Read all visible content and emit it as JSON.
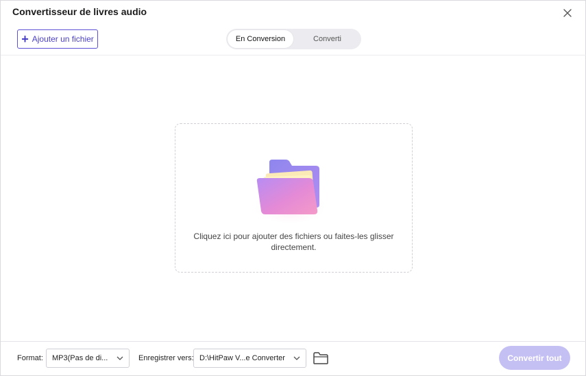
{
  "window": {
    "title": "Convertisseur de livres audio"
  },
  "toolbar": {
    "add_file_label": "Ajouter un fichier"
  },
  "tabs": [
    {
      "label": "En Conversion",
      "active": true
    },
    {
      "label": "Converti",
      "active": false
    }
  ],
  "dropzone": {
    "line1": "Cliquez ici pour ajouter des fichiers ou faites-les glisser",
    "line2": "directement."
  },
  "footer": {
    "format_label": "Format:",
    "format_value": "MP3(Pas de di...",
    "save_label": "Enregistrer vers:",
    "save_path": "D:\\HitPaw V...e Converter",
    "convert_all_label": "Convertir tout"
  },
  "colors": {
    "accent": "#5b4fd6",
    "convert_disabled": "#c5c0f4"
  },
  "icons": {
    "close": "close-icon",
    "plus": "plus-icon",
    "folder_illustration": "folder-illustration",
    "chevron": "chevron-down-icon",
    "browse_folder": "folder-icon"
  }
}
